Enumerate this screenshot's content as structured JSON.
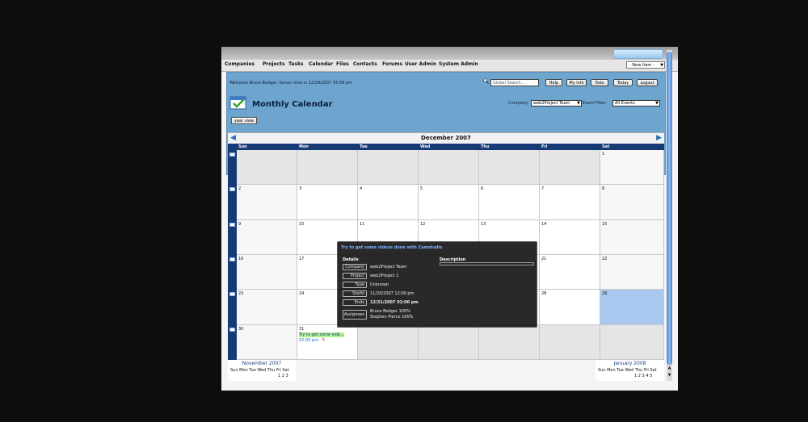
{
  "menu": [
    "Companies",
    "Projects",
    "Tasks",
    "Calendar",
    "Files",
    "Contacts",
    "Forums",
    "User Admin",
    "System Admin"
  ],
  "new_item": "- New Item -",
  "welcome": "Welcome Bruce Bodger. Server time is 12/29/2007 05:09 pm",
  "search_placeholder": "Global Search...",
  "header_buttons": [
    "Help",
    "My Info",
    "Todo",
    "Today",
    "Logout"
  ],
  "page_title": "Monthly Calendar",
  "company_label": "Company:",
  "company_value": "web2Project Team",
  "event_filter_label": "Event Filter:",
  "event_filter_value": "All Events",
  "year_view": "year view",
  "month_title": "December 2007",
  "days": [
    "Sun",
    "Mon",
    "Tue",
    "Wed",
    "Thu",
    "Fri",
    "Sat"
  ],
  "weeks": [
    [
      "",
      "",
      "",
      "",
      "",
      "",
      "1"
    ],
    [
      "2",
      "3",
      "4",
      "5",
      "6",
      "7",
      "8"
    ],
    [
      "9",
      "10",
      "11",
      "12",
      "13",
      "14",
      "15"
    ],
    [
      "16",
      "17",
      "",
      "",
      "",
      "21",
      "22"
    ],
    [
      "23",
      "24",
      "",
      "",
      "",
      "28",
      "29"
    ],
    [
      "30",
      "31",
      "",
      "",
      "",
      "",
      ""
    ]
  ],
  "event": {
    "label": "Try to get some vide...",
    "time": "02:00 pm"
  },
  "popup": {
    "title": "Try to get some videos done with Camstudio",
    "details_label": "Details",
    "description_label": "Description",
    "fields": [
      {
        "label": "Company",
        "value": "web2Project Team"
      },
      {
        "label": "Project",
        "value": "web2Project 1"
      },
      {
        "label": "Type",
        "value": "Unknown"
      },
      {
        "label": "Starts",
        "value": "11/20/2007 12:00 pm"
      },
      {
        "label": "Ends",
        "value": "12/31/2007 02:00 pm"
      },
      {
        "label": "Assignees",
        "value": "Bruce Bodger 100%",
        "value2": "Stephen Pierce 100%"
      }
    ]
  },
  "mini_prev": {
    "title": "November 2007",
    "days": "Sun Mon Tue Wed Thu Fri Sat",
    "nums": "1 2 3"
  },
  "mini_next": {
    "title": "January 2008",
    "days": "Sun Mon Tue Wed Thu Fri Sat",
    "nums": "1 2 3 4 5"
  }
}
